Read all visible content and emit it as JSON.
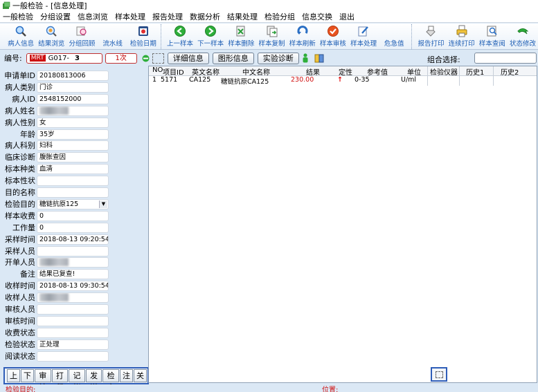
{
  "window": {
    "title": "一般检验 - [信息处理]"
  },
  "menu": [
    "一般检验",
    "分组设置",
    "信息浏览",
    "样本处理",
    "报告处理",
    "数据分析",
    "结果处理",
    "检验分组",
    "信息交换",
    "退出"
  ],
  "toolbar": [
    {
      "label": "病人信息",
      "icon": "magnifier-icon"
    },
    {
      "label": "结果浏览",
      "icon": "browse-icon"
    },
    {
      "label": "分组回顾",
      "icon": "review-icon"
    },
    {
      "label": "流水线",
      "icon": "pipeline-icon"
    },
    {
      "label": "检验日期",
      "icon": "calendar-icon"
    },
    {
      "label": "上一样本",
      "icon": "prev-icon"
    },
    {
      "label": "下一样本",
      "icon": "next-icon"
    },
    {
      "label": "样本删除",
      "icon": "delete-icon"
    },
    {
      "label": "样本复制",
      "icon": "copy-icon"
    },
    {
      "label": "样本刷新",
      "icon": "refresh-icon"
    },
    {
      "label": "样本审核",
      "icon": "audit-icon"
    },
    {
      "label": "样本处理",
      "icon": "process-icon"
    },
    {
      "label": "危急值",
      "icon": "critical-icon"
    },
    {
      "label": "报告打印",
      "icon": "report-print-icon"
    },
    {
      "label": "连续打印",
      "icon": "printer-icon"
    },
    {
      "label": "样本查阅",
      "icon": "lookup-icon"
    },
    {
      "label": "状态修改",
      "icon": "status-icon"
    }
  ],
  "infobar": {
    "id_label": "编号:",
    "id_red_tag": "MRT",
    "id_code": "G017-",
    "id_seq": "3",
    "count": "1次",
    "btn_detail": "详细信息",
    "btn_graph": "图形信息",
    "btn_diagnosis": "实验诊断",
    "group_label": "组合选择:"
  },
  "patient_fields": [
    {
      "label": "申请单ID",
      "value": "20180813006"
    },
    {
      "label": "病人类别",
      "value": "门诊"
    },
    {
      "label": "病人ID",
      "value": "2548152000"
    },
    {
      "label": "病人姓名",
      "value": "",
      "blurred": true
    },
    {
      "label": "病人性别",
      "value": "女"
    },
    {
      "label": "年龄",
      "value": "35岁"
    },
    {
      "label": "病人科别",
      "value": "妇科"
    },
    {
      "label": "临床诊断",
      "value": "腹胀查因"
    },
    {
      "label": "标本种类",
      "value": "血清"
    },
    {
      "label": "标本性状",
      "value": ""
    },
    {
      "label": "目的名称",
      "value": ""
    },
    {
      "label": "检验目的",
      "value": "糖链抗原125",
      "combo": true
    },
    {
      "label": "样本收费",
      "value": "0"
    },
    {
      "label": "工作量",
      "value": "0"
    },
    {
      "label": "采样时间",
      "value": "2018-08-13 09:20:54"
    },
    {
      "label": "采样人员",
      "value": ""
    },
    {
      "label": "开单人员",
      "value": "",
      "blurred": true
    },
    {
      "label": "备注",
      "value": "结果已复查!"
    },
    {
      "label": "收样时间",
      "value": "2018-08-13 09:30:54"
    },
    {
      "label": "收样人员",
      "value": "",
      "blurred": true
    },
    {
      "label": "审核人员",
      "value": ""
    },
    {
      "label": "审核时间",
      "value": ""
    },
    {
      "label": "收费状态",
      "value": ""
    },
    {
      "label": "检验状态",
      "value": "正处理"
    },
    {
      "label": "阅读状态",
      "value": ""
    }
  ],
  "bottom_buttons": [
    "上",
    "下",
    "审核",
    "打印",
    "记帐",
    "发送",
    "检审",
    "注",
    "关"
  ],
  "results": {
    "headers": [
      "NO",
      "项目ID",
      "英文名称",
      "中文名称",
      "结果",
      "定性",
      "参考值",
      "单位",
      "检验仪器",
      "历史1",
      "历史2"
    ],
    "rows": [
      {
        "no": "1",
        "item_id": "5171",
        "en": "CA125",
        "cn": "糖链抗原CA125",
        "result": "230.00",
        "qual": "↑",
        "ref": "0-35",
        "unit": "U/ml",
        "instrument": "",
        "hist1": "",
        "hist2": ""
      }
    ]
  },
  "statusbar": {
    "left": "检验目的:",
    "right": "位置:"
  },
  "colors": {
    "accent": "#2e5db8",
    "abnormal": "#d01010",
    "toolbar_label": "#1c5db4"
  }
}
